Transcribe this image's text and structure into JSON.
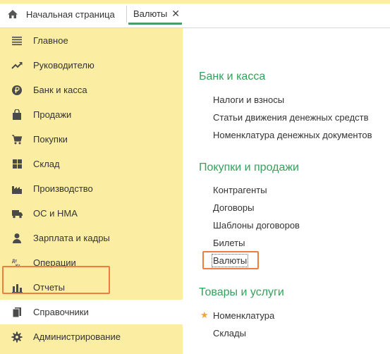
{
  "tabs": {
    "home_label": "Начальная страница",
    "active_label": "Валюты",
    "close_glyph": "✕"
  },
  "sidebar": {
    "items": [
      {
        "label": "Главное",
        "icon": "menu-lines-icon"
      },
      {
        "label": "Руководителю",
        "icon": "trend-up-icon"
      },
      {
        "label": "Банк и касса",
        "icon": "ruble-coin-icon"
      },
      {
        "label": "Продажи",
        "icon": "shopping-bag-icon"
      },
      {
        "label": "Покупки",
        "icon": "shopping-cart-icon"
      },
      {
        "label": "Склад",
        "icon": "warehouse-grid-icon"
      },
      {
        "label": "Производство",
        "icon": "factory-icon"
      },
      {
        "label": "ОС и НМА",
        "icon": "truck-icon"
      },
      {
        "label": "Зарплата и кадры",
        "icon": "person-icon"
      },
      {
        "label": "Операции",
        "icon": "debit-credit-icon"
      },
      {
        "label": "Отчеты",
        "icon": "bar-chart-icon"
      },
      {
        "label": "Справочники",
        "icon": "books-icon"
      },
      {
        "label": "Администрирование",
        "icon": "gear-icon"
      }
    ],
    "active_index": 11
  },
  "content": {
    "groups": [
      {
        "title": "Банк и касса",
        "links": [
          "Налоги и взносы",
          "Статьи движения денежных средств",
          "Номенклатура денежных документов"
        ]
      },
      {
        "title": "Покупки и продажи",
        "links": [
          "Контрагенты",
          "Договоры",
          "Шаблоны договоров",
          "Билеты",
          "Валюты"
        ]
      },
      {
        "title": "Товары и услуги",
        "links": [
          "Номенклатура",
          "Склады"
        ]
      }
    ],
    "favorite_glyph": "★"
  },
  "colors": {
    "sidebar_bg": "#fbeea2",
    "group_title": "#35a15a",
    "highlight": "#ef7d3e",
    "favorite_star": "#f2a33a"
  }
}
